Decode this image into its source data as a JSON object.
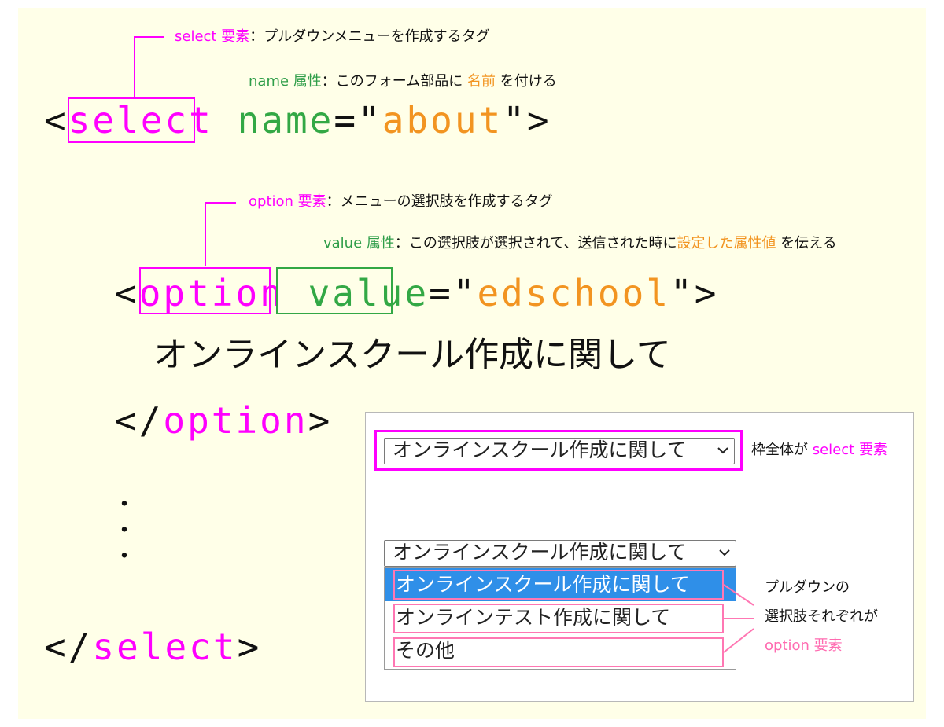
{
  "colors": {
    "background": "#ffffe8",
    "magenta": "#ff00ff",
    "green": "#33a845",
    "orange": "#f29421",
    "pink": "#ff6ab0",
    "dropdown_selected": "#2f8fe8"
  },
  "annotations": {
    "select_elem": {
      "name": "select 要素",
      "desc": "：プルダウンメニューを作成するタグ"
    },
    "name_attr": {
      "name": "name 属性",
      "desc_before": "：このフォーム部品に",
      "highlight": "名前",
      "desc_after": "を付ける"
    },
    "option_elem": {
      "name": "option 要素",
      "desc": "：メニューの選択肢を作成するタグ"
    },
    "value_attr": {
      "name": "value 属性",
      "desc_before": "：この選択肢が選択されて、送信された時に",
      "highlight": "設定した属性値",
      "desc_after": "を伝える"
    }
  },
  "code": {
    "select_open": {
      "lt": "<",
      "tag": "select",
      "attr": "name",
      "eq": "=\"",
      "value": "about",
      "close": "\">"
    },
    "option_open": {
      "lt": "<",
      "tag": "option",
      "attr": "value",
      "eq": "=\"",
      "value": "edschool",
      "close": "\">"
    },
    "option_text": "オンラインスクール作成に関して",
    "option_close": {
      "lt": "</",
      "tag": "option",
      "gt": ">"
    },
    "dots": [
      "・",
      "・",
      "・"
    ],
    "select_close": {
      "lt": "</",
      "tag": "select",
      "gt": ">"
    }
  },
  "preview": {
    "select_closed_value": "オンラインスクール作成に関して",
    "select_label_before": "枠全体が",
    "select_label_elem": "select 要素",
    "select_open_value": "オンラインスクール作成に関して",
    "chevron_icon": "chevron-down-icon",
    "options": [
      "オンラインスクール作成に関して",
      "オンラインテスト作成に関して",
      "その他"
    ],
    "options_label_line1": "プルダウンの",
    "options_label_line2": "選択肢それぞれが",
    "options_label_line3": "option 要素"
  }
}
